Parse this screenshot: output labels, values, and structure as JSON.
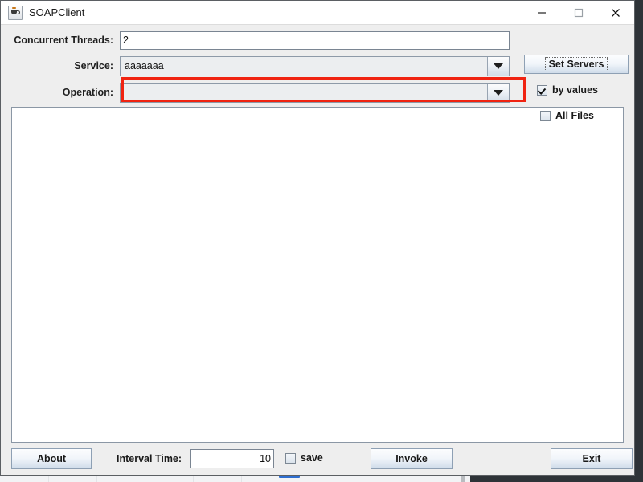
{
  "window": {
    "title": "SOAPClient",
    "icon": "java-cup-icon",
    "controls": {
      "minimize": "minimize-icon",
      "maximize": "maximize-icon",
      "close": "close-icon"
    }
  },
  "form": {
    "threads": {
      "label": "Concurrent Threads:",
      "value": "2"
    },
    "service": {
      "label": "Service:",
      "value": "aaaaaaa",
      "highlighted": true,
      "highlight_color": "#f02311"
    },
    "operation": {
      "label": "Operation:",
      "value": ""
    },
    "set_servers_label": "Set Servers",
    "by_values": {
      "label": "by values",
      "checked": true
    },
    "all_files": {
      "label": "All Files",
      "checked": false
    }
  },
  "output": {
    "text": ""
  },
  "bottom": {
    "about_label": "About",
    "interval_label": "Interval Time:",
    "interval_value": "10",
    "save": {
      "label": "save",
      "checked": false
    },
    "invoke_label": "Invoke",
    "exit_label": "Exit"
  }
}
